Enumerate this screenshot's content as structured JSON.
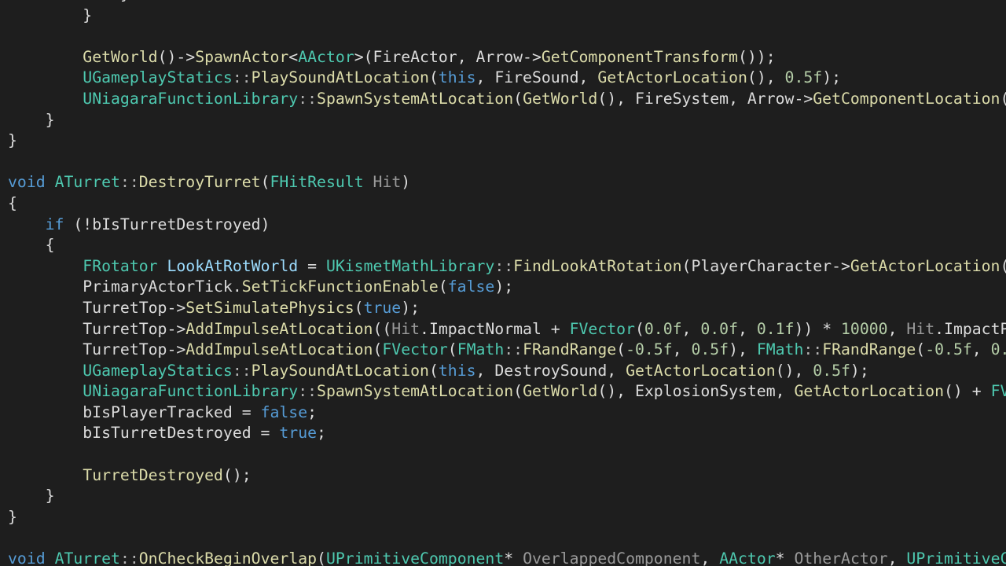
{
  "editor": {
    "language": "cpp",
    "colors": {
      "background": "#1e1e1e",
      "plain": "#dcdcdc",
      "keyword": "#569cd6",
      "type": "#4ec9b0",
      "function": "#dcdcaa",
      "number": "#b5cea8",
      "variable": "#9cdcfe",
      "operator": "#b4b4b4",
      "parameter": "#9a9a9a"
    },
    "lines": [
      [
        {
          "t": "            }",
          "c": "plain"
        }
      ],
      [
        {
          "t": "        }",
          "c": "plain"
        }
      ],
      [],
      [
        {
          "t": "        ",
          "c": "plain"
        },
        {
          "t": "GetWorld",
          "c": "fn"
        },
        {
          "t": "()->",
          "c": "plain"
        },
        {
          "t": "SpawnActor",
          "c": "fn"
        },
        {
          "t": "<",
          "c": "plain"
        },
        {
          "t": "AActor",
          "c": "type"
        },
        {
          "t": ">(FireActor, Arrow->",
          "c": "plain"
        },
        {
          "t": "GetComponentTransform",
          "c": "fn"
        },
        {
          "t": "());",
          "c": "plain"
        }
      ],
      [
        {
          "t": "        ",
          "c": "plain"
        },
        {
          "t": "UGameplayStatics",
          "c": "type"
        },
        {
          "t": "::",
          "c": "op"
        },
        {
          "t": "PlaySoundAtLocation",
          "c": "fn"
        },
        {
          "t": "(",
          "c": "plain"
        },
        {
          "t": "this",
          "c": "kw"
        },
        {
          "t": ", FireSound, ",
          "c": "plain"
        },
        {
          "t": "GetActorLocation",
          "c": "fn"
        },
        {
          "t": "(), ",
          "c": "plain"
        },
        {
          "t": "0.5f",
          "c": "num"
        },
        {
          "t": ");",
          "c": "plain"
        }
      ],
      [
        {
          "t": "        ",
          "c": "plain"
        },
        {
          "t": "UNiagaraFunctionLibrary",
          "c": "type"
        },
        {
          "t": "::",
          "c": "op"
        },
        {
          "t": "SpawnSystemAtLocation",
          "c": "fn"
        },
        {
          "t": "(",
          "c": "plain"
        },
        {
          "t": "GetWorld",
          "c": "fn"
        },
        {
          "t": "(), FireSystem, Arrow->",
          "c": "plain"
        },
        {
          "t": "GetComponentLocation",
          "c": "fn"
        },
        {
          "t": "(",
          "c": "plain"
        }
      ],
      [
        {
          "t": "    }",
          "c": "plain"
        }
      ],
      [
        {
          "t": "}",
          "c": "plain"
        }
      ],
      [],
      [
        {
          "t": "void",
          "c": "kw"
        },
        {
          "t": " ",
          "c": "plain"
        },
        {
          "t": "ATurret",
          "c": "type"
        },
        {
          "t": "::",
          "c": "op"
        },
        {
          "t": "DestroyTurret",
          "c": "fn"
        },
        {
          "t": "(",
          "c": "plain"
        },
        {
          "t": "FHitResult",
          "c": "type"
        },
        {
          "t": " ",
          "c": "plain"
        },
        {
          "t": "Hit",
          "c": "param"
        },
        {
          "t": ")",
          "c": "plain"
        }
      ],
      [
        {
          "t": "{",
          "c": "plain"
        }
      ],
      [
        {
          "t": "    ",
          "c": "plain"
        },
        {
          "t": "if",
          "c": "kw"
        },
        {
          "t": " (!bIsTurretDestroyed)",
          "c": "plain"
        }
      ],
      [
        {
          "t": "    {",
          "c": "plain"
        }
      ],
      [
        {
          "t": "        ",
          "c": "plain"
        },
        {
          "t": "FRotator",
          "c": "type"
        },
        {
          "t": " ",
          "c": "plain"
        },
        {
          "t": "LookAtRotWorld",
          "c": "var"
        },
        {
          "t": " = ",
          "c": "plain"
        },
        {
          "t": "UKismetMathLibrary",
          "c": "type"
        },
        {
          "t": "::",
          "c": "op"
        },
        {
          "t": "FindLookAtRotation",
          "c": "fn"
        },
        {
          "t": "(PlayerCharacter->",
          "c": "plain"
        },
        {
          "t": "GetActorLocation",
          "c": "fn"
        },
        {
          "t": "(",
          "c": "plain"
        }
      ],
      [
        {
          "t": "        PrimaryActorTick.",
          "c": "plain"
        },
        {
          "t": "SetTickFunctionEnable",
          "c": "fn"
        },
        {
          "t": "(",
          "c": "plain"
        },
        {
          "t": "false",
          "c": "kw"
        },
        {
          "t": ");",
          "c": "plain"
        }
      ],
      [
        {
          "t": "        TurretTop->",
          "c": "plain"
        },
        {
          "t": "SetSimulatePhysics",
          "c": "fn"
        },
        {
          "t": "(",
          "c": "plain"
        },
        {
          "t": "true",
          "c": "kw"
        },
        {
          "t": ");",
          "c": "plain"
        }
      ],
      [
        {
          "t": "        TurretTop->",
          "c": "plain"
        },
        {
          "t": "AddImpulseAtLocation",
          "c": "fn"
        },
        {
          "t": "((",
          "c": "plain"
        },
        {
          "t": "Hit",
          "c": "param"
        },
        {
          "t": ".ImpactNormal + ",
          "c": "plain"
        },
        {
          "t": "FVector",
          "c": "type"
        },
        {
          "t": "(",
          "c": "plain"
        },
        {
          "t": "0.0f",
          "c": "num"
        },
        {
          "t": ", ",
          "c": "plain"
        },
        {
          "t": "0.0f",
          "c": "num"
        },
        {
          "t": ", ",
          "c": "plain"
        },
        {
          "t": "0.1f",
          "c": "num"
        },
        {
          "t": ")) * ",
          "c": "plain"
        },
        {
          "t": "10000",
          "c": "num"
        },
        {
          "t": ", ",
          "c": "plain"
        },
        {
          "t": "Hit",
          "c": "param"
        },
        {
          "t": ".ImpactP",
          "c": "plain"
        }
      ],
      [
        {
          "t": "        TurretTop->",
          "c": "plain"
        },
        {
          "t": "AddImpulseAtLocation",
          "c": "fn"
        },
        {
          "t": "(",
          "c": "plain"
        },
        {
          "t": "FVector",
          "c": "type"
        },
        {
          "t": "(",
          "c": "plain"
        },
        {
          "t": "FMath",
          "c": "type"
        },
        {
          "t": "::",
          "c": "op"
        },
        {
          "t": "FRandRange",
          "c": "fn"
        },
        {
          "t": "(",
          "c": "plain"
        },
        {
          "t": "-0.5f",
          "c": "num"
        },
        {
          "t": ", ",
          "c": "plain"
        },
        {
          "t": "0.5f",
          "c": "num"
        },
        {
          "t": "), ",
          "c": "plain"
        },
        {
          "t": "FMath",
          "c": "type"
        },
        {
          "t": "::",
          "c": "op"
        },
        {
          "t": "FRandRange",
          "c": "fn"
        },
        {
          "t": "(",
          "c": "plain"
        },
        {
          "t": "-0.5f",
          "c": "num"
        },
        {
          "t": ", ",
          "c": "plain"
        },
        {
          "t": "0.",
          "c": "num"
        }
      ],
      [
        {
          "t": "        ",
          "c": "plain"
        },
        {
          "t": "UGameplayStatics",
          "c": "type"
        },
        {
          "t": "::",
          "c": "op"
        },
        {
          "t": "PlaySoundAtLocation",
          "c": "fn"
        },
        {
          "t": "(",
          "c": "plain"
        },
        {
          "t": "this",
          "c": "kw"
        },
        {
          "t": ", DestroySound, ",
          "c": "plain"
        },
        {
          "t": "GetActorLocation",
          "c": "fn"
        },
        {
          "t": "(), ",
          "c": "plain"
        },
        {
          "t": "0.5f",
          "c": "num"
        },
        {
          "t": ");",
          "c": "plain"
        }
      ],
      [
        {
          "t": "        ",
          "c": "plain"
        },
        {
          "t": "UNiagaraFunctionLibrary",
          "c": "type"
        },
        {
          "t": "::",
          "c": "op"
        },
        {
          "t": "SpawnSystemAtLocation",
          "c": "fn"
        },
        {
          "t": "(",
          "c": "plain"
        },
        {
          "t": "GetWorld",
          "c": "fn"
        },
        {
          "t": "(), ExplosionSystem, ",
          "c": "plain"
        },
        {
          "t": "GetActorLocation",
          "c": "fn"
        },
        {
          "t": "() + ",
          "c": "plain"
        },
        {
          "t": "FV",
          "c": "type"
        }
      ],
      [
        {
          "t": "        bIsPlayerTracked = ",
          "c": "plain"
        },
        {
          "t": "false",
          "c": "kw"
        },
        {
          "t": ";",
          "c": "plain"
        }
      ],
      [
        {
          "t": "        bIsTurretDestroyed = ",
          "c": "plain"
        },
        {
          "t": "true",
          "c": "kw"
        },
        {
          "t": ";",
          "c": "plain"
        }
      ],
      [],
      [
        {
          "t": "        ",
          "c": "plain"
        },
        {
          "t": "TurretDestroyed",
          "c": "fn"
        },
        {
          "t": "();",
          "c": "plain"
        }
      ],
      [
        {
          "t": "    }",
          "c": "plain"
        }
      ],
      [
        {
          "t": "}",
          "c": "plain"
        }
      ],
      [],
      [
        {
          "t": "void",
          "c": "kw"
        },
        {
          "t": " ",
          "c": "plain"
        },
        {
          "t": "ATurret",
          "c": "type"
        },
        {
          "t": "::",
          "c": "op"
        },
        {
          "t": "OnCheckBeginOverlap",
          "c": "fn"
        },
        {
          "t": "(",
          "c": "plain"
        },
        {
          "t": "UPrimitiveComponent",
          "c": "type"
        },
        {
          "t": "* ",
          "c": "plain"
        },
        {
          "t": "OverlappedComponent",
          "c": "param"
        },
        {
          "t": ", ",
          "c": "plain"
        },
        {
          "t": "AActor",
          "c": "type"
        },
        {
          "t": "* ",
          "c": "plain"
        },
        {
          "t": "OtherActor",
          "c": "param"
        },
        {
          "t": ", ",
          "c": "plain"
        },
        {
          "t": "UPrimitiveC",
          "c": "type"
        }
      ]
    ]
  }
}
